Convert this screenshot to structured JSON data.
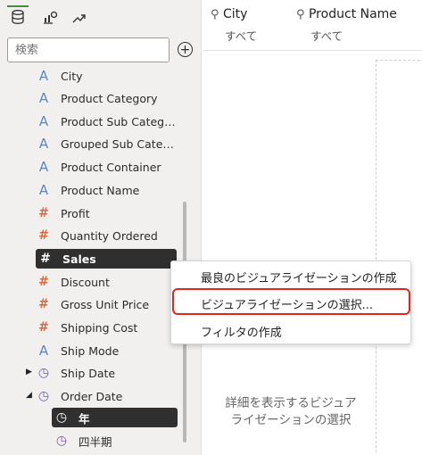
{
  "left_panel": {
    "search": {
      "placeholder": "検索"
    },
    "tabs": [
      {
        "name": "data-tab",
        "icon": "database-icon",
        "active": true
      },
      {
        "name": "visualizations-tab",
        "icon": "chart-settings-icon",
        "active": false
      },
      {
        "name": "analytics-tab",
        "icon": "trend-icon",
        "active": false
      }
    ],
    "items": [
      {
        "label": "City",
        "kind": "attr"
      },
      {
        "label": "Product Category",
        "kind": "attr"
      },
      {
        "label": "Product Sub Categor…",
        "kind": "attr"
      },
      {
        "label": "Grouped Sub Catego…",
        "kind": "attr"
      },
      {
        "label": "Product Container",
        "kind": "attr"
      },
      {
        "label": "Product Name",
        "kind": "attr"
      },
      {
        "label": "Profit",
        "kind": "measure"
      },
      {
        "label": "Quantity Ordered",
        "kind": "measure"
      },
      {
        "label": "Sales",
        "kind": "measure",
        "selected": true
      },
      {
        "label": "Discount",
        "kind": "measure"
      },
      {
        "label": "Gross Unit Price",
        "kind": "measure"
      },
      {
        "label": "Shipping Cost",
        "kind": "measure"
      },
      {
        "label": "Ship Mode",
        "kind": "attr"
      },
      {
        "label": "Ship Date",
        "kind": "time",
        "expander": "▶"
      },
      {
        "label": "Order Date",
        "kind": "time",
        "expander": "◢"
      },
      {
        "label": "年",
        "kind": "time",
        "selected": true,
        "child": true
      },
      {
        "label": "四半期",
        "kind": "time",
        "child": true
      }
    ]
  },
  "filters": [
    {
      "label": "City",
      "value": "すべて"
    },
    {
      "label": "Product Name",
      "value": "すべて"
    }
  ],
  "context_menu": {
    "items": [
      {
        "label": "最良のビジュアライゼーションの作成"
      },
      {
        "label": "ビジュアライゼーションの選択..."
      },
      {
        "label": "フィルタの作成"
      }
    ]
  },
  "canvas": {
    "hint_line1": "詳細を表示するビジュア",
    "hint_line2": "ライゼーションの選択"
  },
  "colors": {
    "attribute": "#5b86c4",
    "measure": "#d8693f",
    "time": "#7a5aa8",
    "highlight": "#e1261c",
    "active_tab": "#4a8c3f"
  }
}
